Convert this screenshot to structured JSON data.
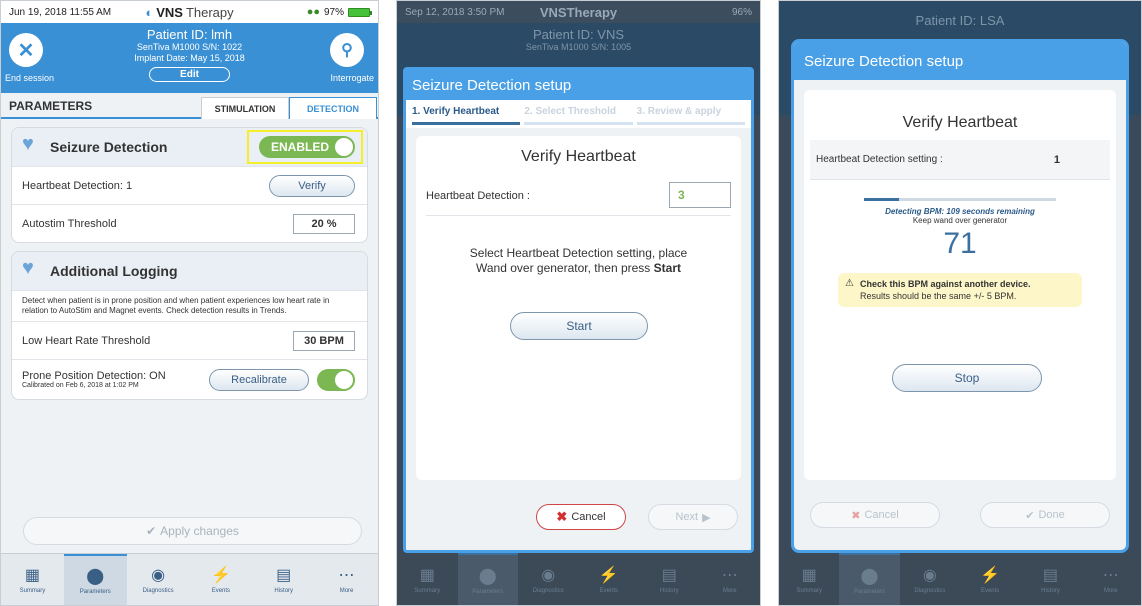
{
  "screen1": {
    "status": {
      "time": "Jun 19, 2018  11:55 AM",
      "brand_bold": "VNS",
      "brand_light": "Therapy",
      "battery": "97%"
    },
    "header": {
      "patient_id": "Patient ID: lmh",
      "device": "SenTiva M1000 S/N: 1022",
      "implant": "Implant Date: May 15, 2018",
      "edit": "Edit",
      "end_session": "End session",
      "interrogate": "Interrogate"
    },
    "parameters_title": "PARAMETERS",
    "tabs": {
      "stimulation": "STIMULATION",
      "detection": "DETECTION"
    },
    "seizure": {
      "title": "Seizure Detection",
      "toggle": "ENABLED",
      "hb_label": "Heartbeat Detection: 1",
      "verify": "Verify",
      "autostim_label": "Autostim Threshold",
      "autostim_value": "20 %"
    },
    "logging": {
      "title": "Additional Logging",
      "description": "Detect when patient is in prone position and when patient experiences low heart rate in relation to AutoStim and Magnet events. Check detection results in Trends.",
      "low_hr_label": "Low Heart Rate Threshold",
      "low_hr_value": "30 BPM",
      "prone_label": "Prone Position Detection: ON",
      "prone_sub": "Calibrated on Feb 6, 2018 at 1:02 PM",
      "recalibrate": "Recalibrate"
    },
    "apply": "Apply changes"
  },
  "nav": [
    "Summary",
    "Parameters",
    "Diagnostics",
    "Events",
    "History",
    "More"
  ],
  "screen2": {
    "status": {
      "time": "Sep 12, 2018  3:50 PM",
      "brand": "VNSTherapy",
      "battery": "96%"
    },
    "bg_patient": "Patient ID: VNS",
    "bg_device": "SenTiva M1000 S/N: 1005",
    "modal_title": "Seizure Detection setup",
    "steps": [
      "1. Verify Heartbeat",
      "2. Select Threshold",
      "3. Review & apply"
    ],
    "panel_title": "Verify Heartbeat",
    "hb_label": "Heartbeat Detection :",
    "hb_value": "3",
    "instruction": "Select Heartbeat Detection setting, place Wand over generator, then press",
    "instruction_bold": "Start",
    "start": "Start",
    "cancel": "Cancel",
    "next": "Next"
  },
  "screen3": {
    "bg_patient": "Patient ID: LSA",
    "modal_title": "Seizure Detection setup",
    "panel_title": "Verify Heartbeat",
    "hb_label": "Heartbeat Detection setting :",
    "hb_value": "1",
    "progress": 0.18,
    "detecting": "Detecting BPM: 109 seconds remaining",
    "keep": "Keep wand over generator",
    "bpm": "71",
    "warn_bold": "Check this BPM against another device.",
    "warn_text": "Results should be the same +/- 5 BPM.",
    "stop": "Stop",
    "cancel": "Cancel",
    "done": "Done"
  }
}
